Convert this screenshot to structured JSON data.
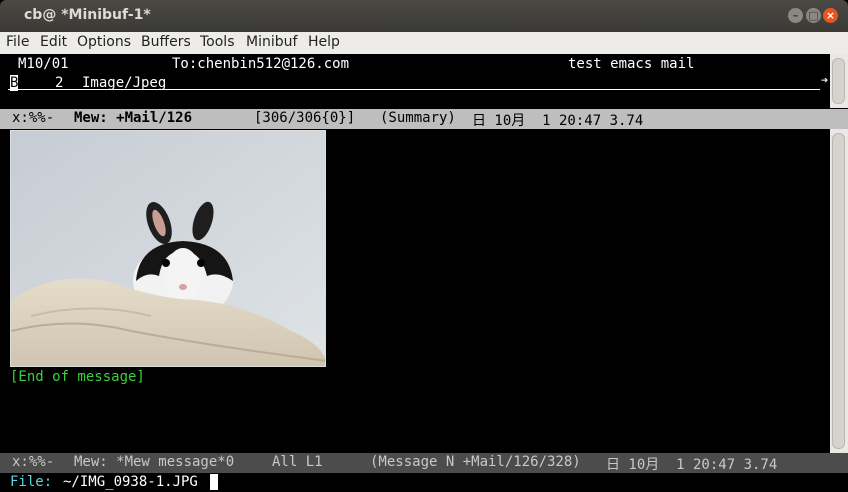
{
  "window": {
    "title": "cb@ *Minibuf-1*",
    "buttons": {
      "minimize": "–",
      "maximize": "□",
      "close": "×"
    }
  },
  "menu": {
    "items": [
      "File",
      "Edit",
      "Options",
      "Buffers",
      "Tools",
      "Minibuf",
      "Help"
    ]
  },
  "summary": {
    "row1": {
      "mark_date": "M10/01",
      "to": "To:chenbin512@126.com",
      "subject": "test emacs mail"
    },
    "row2": {
      "cursor": "B",
      "part_number": "2",
      "part_type": "Image/Jpeg"
    },
    "continuation_glyph": "➔"
  },
  "modeline_top": {
    "flags": "x:%%-",
    "buffer": "Mew: +Mail/126",
    "position": "[306/306{0}]",
    "mode": "(Summary)",
    "datetime": "日 10月  1 20:47 3.74"
  },
  "message": {
    "end_text": "[End of message]",
    "image_description": "photo-of-black-and-white-rabbit"
  },
  "modeline_bottom": {
    "flags": "x:%%-",
    "buffer": "Mew: *Mew message*0",
    "position": "All L1",
    "mode": "(Message N +Mail/126/328)",
    "datetime": "日 10月  1 20:47 3.74"
  },
  "minibuffer": {
    "prompt": "File:",
    "value": "~/IMG_0938-1.JPG"
  },
  "colors": {
    "end_text": "#3ccf3c",
    "prompt": "#5ad6e8",
    "close_button": "#e95420"
  }
}
